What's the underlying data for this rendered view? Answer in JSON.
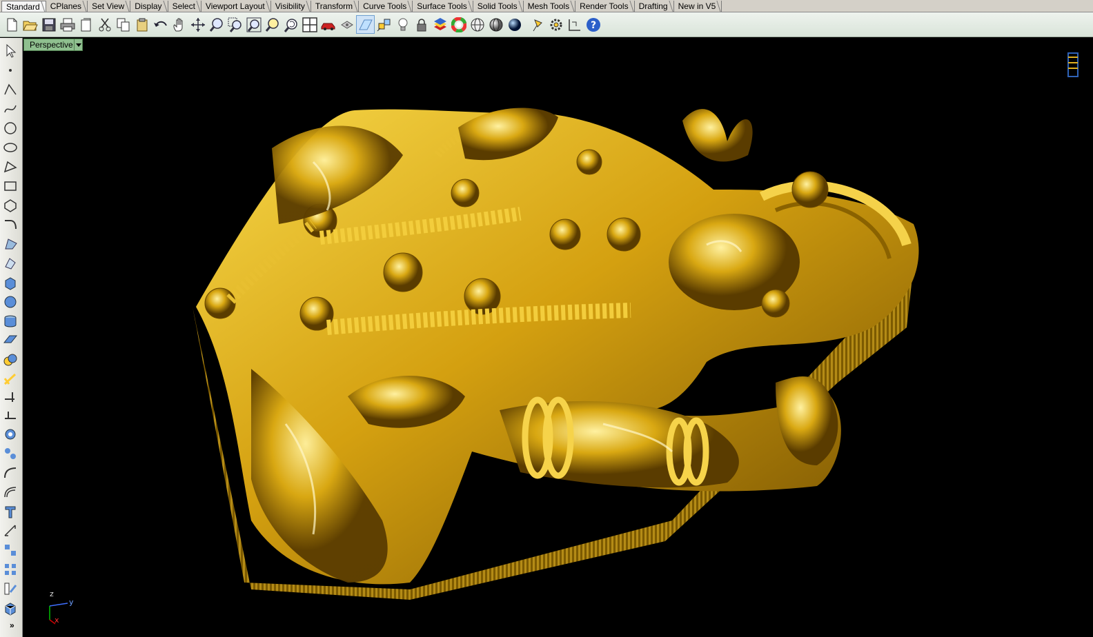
{
  "tabs": [
    "Standard",
    "CPlanes",
    "Set View",
    "Display",
    "Select",
    "Viewport Layout",
    "Visibility",
    "Transform",
    "Curve Tools",
    "Surface Tools",
    "Solid Tools",
    "Mesh Tools",
    "Render Tools",
    "Drafting",
    "New in V5"
  ],
  "active_tab": "Standard",
  "toolbar_icons": [
    "new-file-icon",
    "open-file-icon",
    "save-icon",
    "print-icon",
    "copy-to-clipboard-icon",
    "cut-icon",
    "copy-icon",
    "paste-icon",
    "undo-icon",
    "pan-hand-icon",
    "rotate-view-icon",
    "zoom-icon",
    "zoom-window-icon",
    "zoom-extents-icon",
    "zoom-selected-icon",
    "undo-view-icon",
    "four-viewports-icon",
    "car-icon",
    "camera-icon",
    "cplane-icon",
    "lights-icon",
    "light-bulb-icon",
    "lock-icon",
    "layer-icon",
    "color-wheel-icon",
    "wireframe-sphere-icon",
    "shaded-sphere-icon",
    "rendered-sphere-icon",
    "pin-icon",
    "gear-icon",
    "dimension-icon",
    "help-icon"
  ],
  "left_tools": [
    "select-arrow-icon",
    "point-icon",
    "polyline-icon",
    "curve-icon",
    "circle-icon",
    "ellipse-icon",
    "arc-icon",
    "rectangle-icon",
    "polygon-icon",
    "fillet-curve-icon",
    "surface-corner-icon",
    "extrude-surface-icon",
    "box-icon",
    "sphere-icon",
    "cylinder-icon",
    "plane-icon",
    "boolean-icon",
    "rebuild-icon",
    "trim-icon",
    "split-icon",
    "join-icon",
    "explode-icon",
    "fillet-icon",
    "offset-icon",
    "text-icon",
    "dimension-icon",
    "transform-icon",
    "array-icon",
    "properties-icon",
    "mesh-icon"
  ],
  "viewport": {
    "title": "Perspective",
    "axis_x": "x",
    "axis_y": "y",
    "axis_z": "z"
  },
  "more_label": "»",
  "colors": {
    "gold": "#d4a010",
    "viewport_bg": "#000000",
    "viewport_tab": "#8fbf8f"
  }
}
